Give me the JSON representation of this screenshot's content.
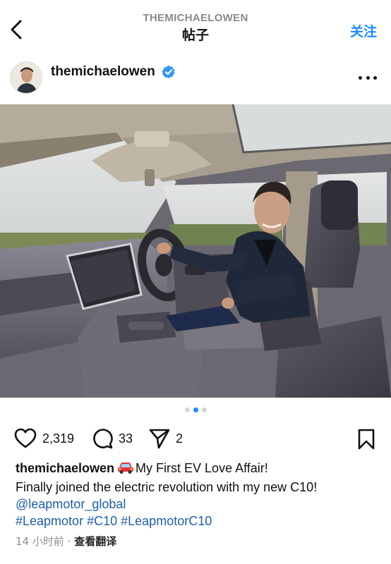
{
  "header": {
    "subtitle": "THEMICHAELOWEN",
    "title": "帖子",
    "follow_label": "关注"
  },
  "post": {
    "username": "themichaelowen",
    "verified": true,
    "carousel": {
      "total": 3,
      "active_index": 1
    },
    "likes": "2,319",
    "comments": "33",
    "shares": "2",
    "caption": {
      "username": "themichaelowen",
      "emoji": "car-icon",
      "title": "My First EV Love Affair!",
      "line2": "Finally joined the electric revolution with my new C10!",
      "mention": "@leapmotor_global",
      "hashtags": [
        "#Leapmotor",
        "#C10",
        "#LeapmotorC10"
      ]
    },
    "time": "14 小时前",
    "separator": "·",
    "translate_label": "查看翻译"
  },
  "colors": {
    "accent": "#1a8cff",
    "link": "#1e5fa8",
    "verified": "#3897f0",
    "muted": "#8e8e8e"
  }
}
